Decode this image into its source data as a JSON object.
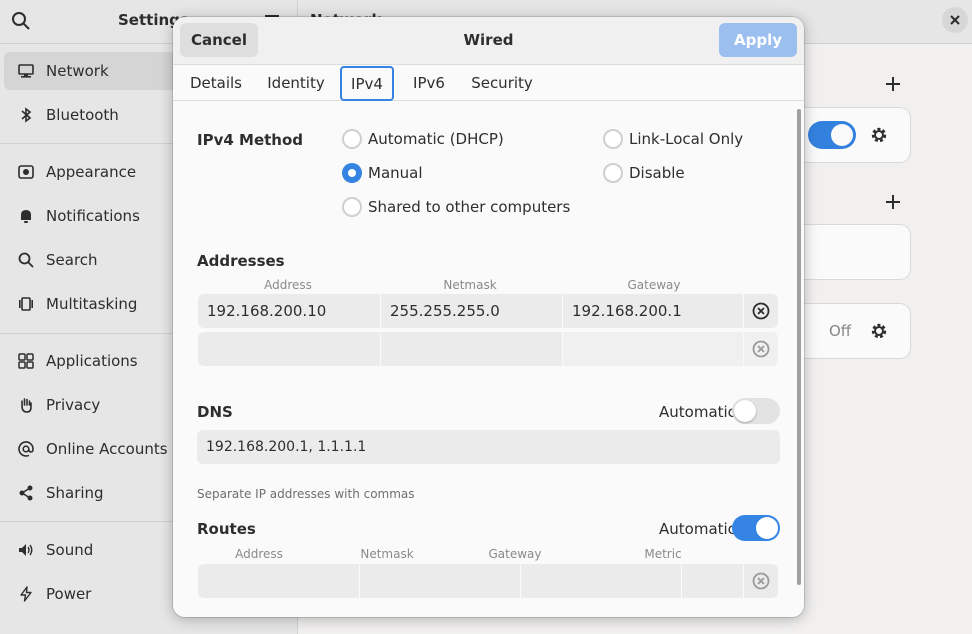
{
  "settings": {
    "title": "Settings",
    "main_title": "Network",
    "sidebar": [
      {
        "label": "Network",
        "icon": "network-icon"
      },
      {
        "label": "Bluetooth",
        "icon": "bluetooth-icon"
      },
      {
        "label": "Appearance",
        "icon": "appearance-icon"
      },
      {
        "label": "Notifications",
        "icon": "bell-icon"
      },
      {
        "label": "Search",
        "icon": "search-icon"
      },
      {
        "label": "Multitasking",
        "icon": "multitasking-icon"
      },
      {
        "label": "Applications",
        "icon": "apps-grid-icon"
      },
      {
        "label": "Privacy",
        "icon": "hand-icon"
      },
      {
        "label": "Online Accounts",
        "icon": "at-icon"
      },
      {
        "label": "Sharing",
        "icon": "share-icon"
      },
      {
        "label": "Sound",
        "icon": "speaker-icon"
      },
      {
        "label": "Power",
        "icon": "power-icon"
      }
    ],
    "vpn_state": "Off"
  },
  "dialog": {
    "title": "Wired",
    "cancel_label": "Cancel",
    "apply_label": "Apply",
    "tabs": [
      "Details",
      "Identity",
      "IPv4",
      "IPv6",
      "Security"
    ],
    "active_tab": "IPv4",
    "ipv4": {
      "method_label": "IPv4 Method",
      "methods": {
        "automatic": "Automatic (DHCP)",
        "link_local": "Link-Local Only",
        "manual": "Manual",
        "disable": "Disable",
        "shared": "Shared to other computers"
      },
      "selected_method": "Manual",
      "addresses": {
        "label": "Addresses",
        "columns": [
          "Address",
          "Netmask",
          "Gateway"
        ],
        "rows": [
          {
            "address": "192.168.200.10",
            "netmask": "255.255.255.0",
            "gateway": "192.168.200.1"
          },
          {
            "address": "",
            "netmask": "",
            "gateway": ""
          }
        ]
      },
      "dns": {
        "label": "DNS",
        "automatic_label": "Automatic",
        "automatic": false,
        "value": "192.168.200.1, 1.1.1.1",
        "hint": "Separate IP addresses with commas"
      },
      "routes": {
        "label": "Routes",
        "automatic_label": "Automatic",
        "automatic": true,
        "columns": [
          "Address",
          "Netmask",
          "Gateway",
          "Metric"
        ]
      }
    }
  },
  "colors": {
    "accent": "#3584e4",
    "apply_disabled": "#9bbfef"
  }
}
